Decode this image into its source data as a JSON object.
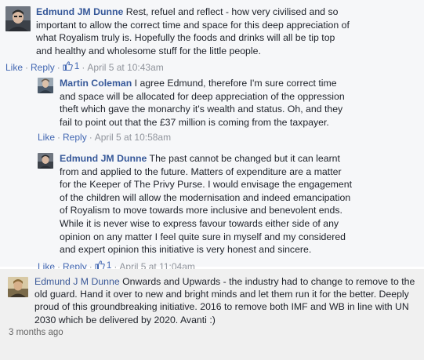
{
  "thread": {
    "comments": [
      {
        "author": "Edmund JM Dunne",
        "text": " Rest, refuel and reflect - how very civilised and so important to allow the correct time and space for this deep appreciation of what Royalism truly is. Hopefully the foods and drinks will all be tip top and healthy and wholesome stuff for the little people.",
        "like_label": "Like",
        "reply_label": "Reply",
        "like_count": "1",
        "timestamp": "April 5 at 10:43am"
      },
      {
        "author": "Martin Coleman",
        "text": " I agree Edmund, therefore I'm sure correct time and space will be allocated for deep appreciation of the oppression theft which gave the monarchy it's wealth and status. Oh, and they fail to point out that the £37 million is coming from the taxpayer.",
        "like_label": "Like",
        "reply_label": "Reply",
        "timestamp": "April 5 at 10:58am"
      },
      {
        "author": "Edmund JM Dunne",
        "text": " The past cannot be changed but it can learnt from and applied to the future. Matters of expenditure are a matter for the Keeper of The Privy Purse. I would envisage the engagement of the children will allow the modernisation and indeed emancipation of Royalism to move towards more inclusive and benevolent ends. While it is never wise to express favour towards either side of any opinion on any matter I feel quite sure in myself and my considered and expert opinion this initiative is very honest and sincere.",
        "like_label": "Like",
        "reply_label": "Reply",
        "like_count": "1",
        "timestamp": "April 5 at 11:04am"
      }
    ]
  },
  "second_comment": {
    "author": "Edmund J M Dunne",
    "text": " Onwards and Upwards - the industry had to change to remove to the old guard. Hand it over to new and bright minds and let them run it for the better. Deeply proud of this groundbreaking initiative. 2016 to remove both IMF and WB in line with UN 2030 which be delivered by 2020. Avanti :)",
    "timestamp": "3 months ago"
  },
  "icons": {
    "like": "thumbs-up-icon"
  },
  "colors": {
    "link": "#4267b2",
    "author": "#365899",
    "meta": "#90949c"
  }
}
